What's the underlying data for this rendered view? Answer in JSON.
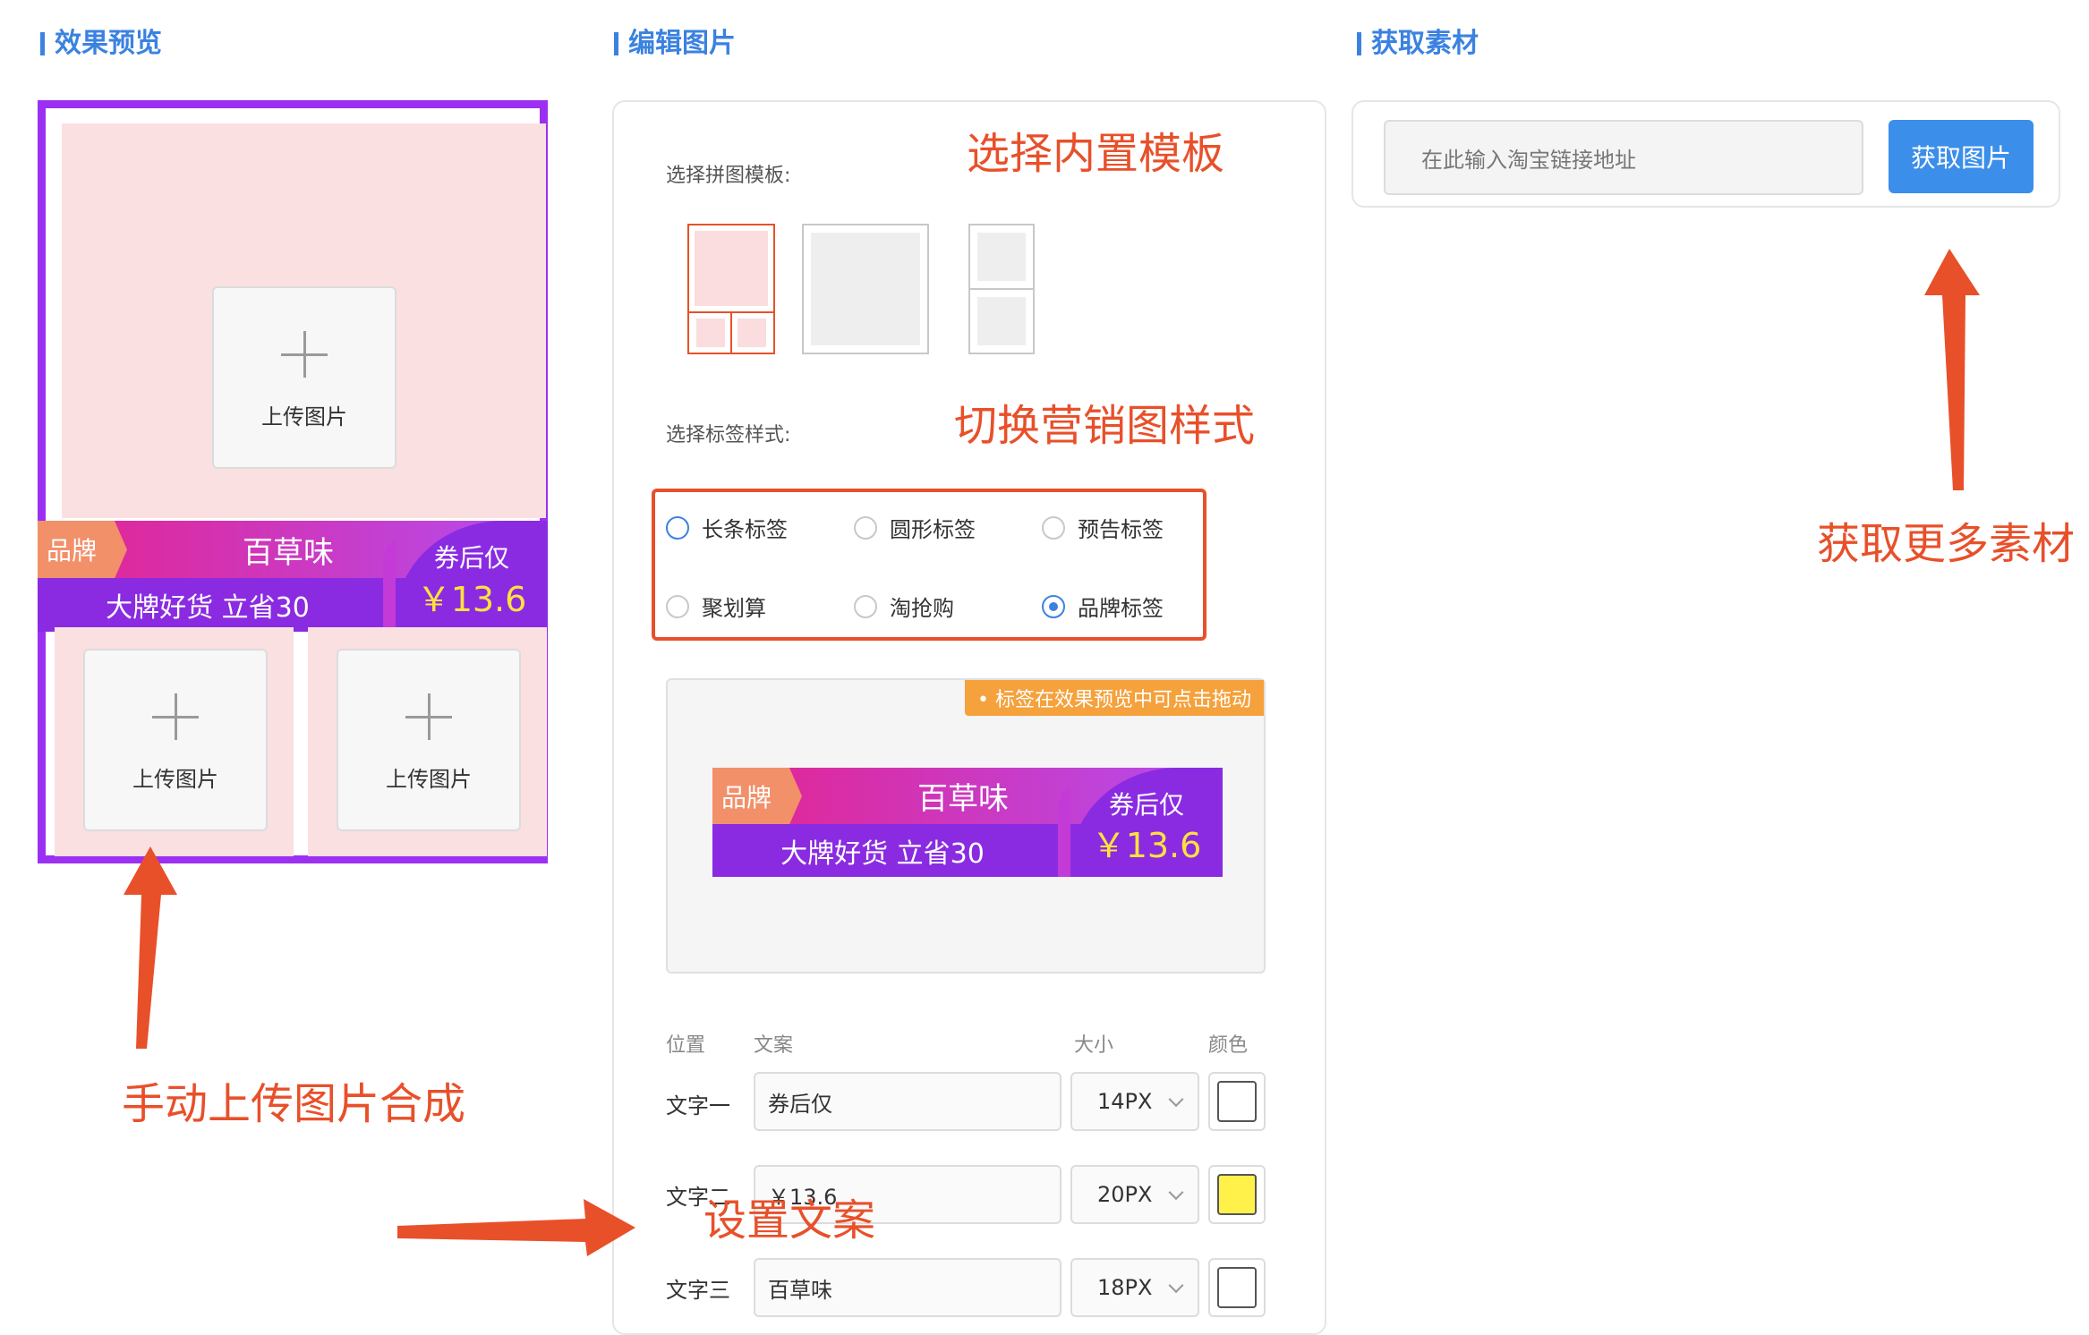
{
  "sections": {
    "preview_title": "效果预览",
    "edit_title": "编辑图片",
    "fetch_title": "获取素材"
  },
  "preview": {
    "upload_label": "上传图片"
  },
  "tag_banner": {
    "brand": "品牌",
    "flavor": "百草味",
    "slogan": "大牌好货 立省30",
    "coupon": "券后仅",
    "price": "￥13.6"
  },
  "editor": {
    "template_label": "选择拼图模板:",
    "tag_style_label": "选择标签样式:",
    "tag_options": [
      {
        "label": "长条标签",
        "selected": false
      },
      {
        "label": "圆形标签",
        "selected": false
      },
      {
        "label": "预告标签",
        "selected": false
      },
      {
        "label": "聚划算",
        "selected": false
      },
      {
        "label": "淘抢购",
        "selected": false
      },
      {
        "label": "品牌标签",
        "selected": true
      }
    ],
    "drag_hint": "• 标签在效果预览中可点击拖动",
    "table_headers": {
      "position": "位置",
      "text": "文案",
      "size": "大小",
      "color": "颜色"
    },
    "rows": [
      {
        "label": "文字一",
        "text": "券后仅",
        "size": "14PX",
        "color": "#ffffff"
      },
      {
        "label": "文字二",
        "text": "￥13.6",
        "size": "20PX",
        "color": "#fff04a"
      },
      {
        "label": "文字三",
        "text": "百草味",
        "size": "18PX",
        "color": "#ffffff"
      }
    ]
  },
  "fetch": {
    "placeholder": "在此输入淘宝链接地址",
    "button_label": "获取图片"
  },
  "annotations": {
    "template": "选择内置模板",
    "tag_style": "切换营销图样式",
    "more_material": "获取更多素材",
    "manual_upload": "手动上传图片合成",
    "set_text": "设置文案"
  },
  "colors": {
    "accent": "#3b82e0",
    "annotation": "#e8502a",
    "frame": "#9b30f2",
    "tile_bg": "#fbe0e1"
  }
}
